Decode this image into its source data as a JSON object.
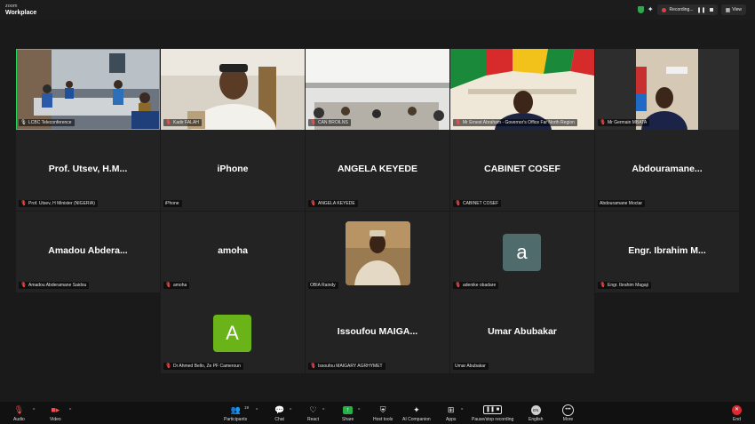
{
  "app": {
    "logo_top": "zoom",
    "logo_bottom": "Workplace"
  },
  "status": {
    "recording": "Recording...",
    "view": "View",
    "shield_color": "#2fa84f"
  },
  "gallery": {
    "video_tiles": [
      {
        "label": "LCBC Teleconference"
      },
      {
        "label": "Kadir FALAH"
      },
      {
        "label": "CAN BROILNS"
      },
      {
        "label": "Mr Ernest Abraham - Governor's Office Far North Region"
      },
      {
        "label": "Mr Germain MBATA"
      }
    ],
    "tiles": [
      {
        "display": "Prof. Utsev, H.M...",
        "label": "Prof. Utsev, H Minister (NIGERIA)"
      },
      {
        "display": "iPhone",
        "label": "iPhone"
      },
      {
        "display": "ANGELA KEYEDE",
        "label": "ANGELA KEYEDE"
      },
      {
        "display": "CABINET COSEF",
        "label": "CABINET COSEF"
      },
      {
        "display": "Abdouramane...",
        "label": "Abdouramane Moctar"
      },
      {
        "display": "Amadou Abdera...",
        "label": "Amadou Abderamane Saidou"
      },
      {
        "display": "amoha",
        "label": "amoha"
      },
      {
        "display": "",
        "label": "OBIA Raindy"
      },
      {
        "avatar": "a",
        "label": "adenike obadare"
      },
      {
        "display": "Engr. Ibrahim M...",
        "label": "Engr. Ibrahim Magaji"
      },
      {
        "avatar": "A",
        "label": "Dr Ahmed Bello, Ze PF Cameroun"
      },
      {
        "display": "Issoufou MAIGA...",
        "label": "Issoufou MAIGARY AGRHYMET"
      },
      {
        "display": "Umar Abubakar",
        "label": "Umar Abubakar"
      }
    ],
    "avatar_colors": {
      "a": "#4f6b6b",
      "A": "#6ab419"
    }
  },
  "toolbar": {
    "audio": "Audio",
    "video": "Video",
    "participants": "Participants",
    "participants_count": "19",
    "chat": "Chat",
    "react": "React",
    "share": "Share",
    "host_tools": "Host tools",
    "ai_companion": "AI Companion",
    "apps": "Apps",
    "pause_stop": "Pause/stop recording",
    "english": "English",
    "english_code": "EN",
    "more": "More",
    "end": "End"
  },
  "icons": [
    "shield-icon",
    "sparkle-icon",
    "record-dot-icon",
    "pause-icon",
    "stop-icon",
    "grid-icon",
    "mic-muted-icon",
    "video-muted-icon",
    "participants-icon",
    "chat-icon",
    "react-icon",
    "share-icon",
    "host-tools-icon",
    "ai-companion-icon",
    "apps-icon",
    "pause-recording-icon",
    "language-icon",
    "more-icon",
    "end-icon"
  ]
}
